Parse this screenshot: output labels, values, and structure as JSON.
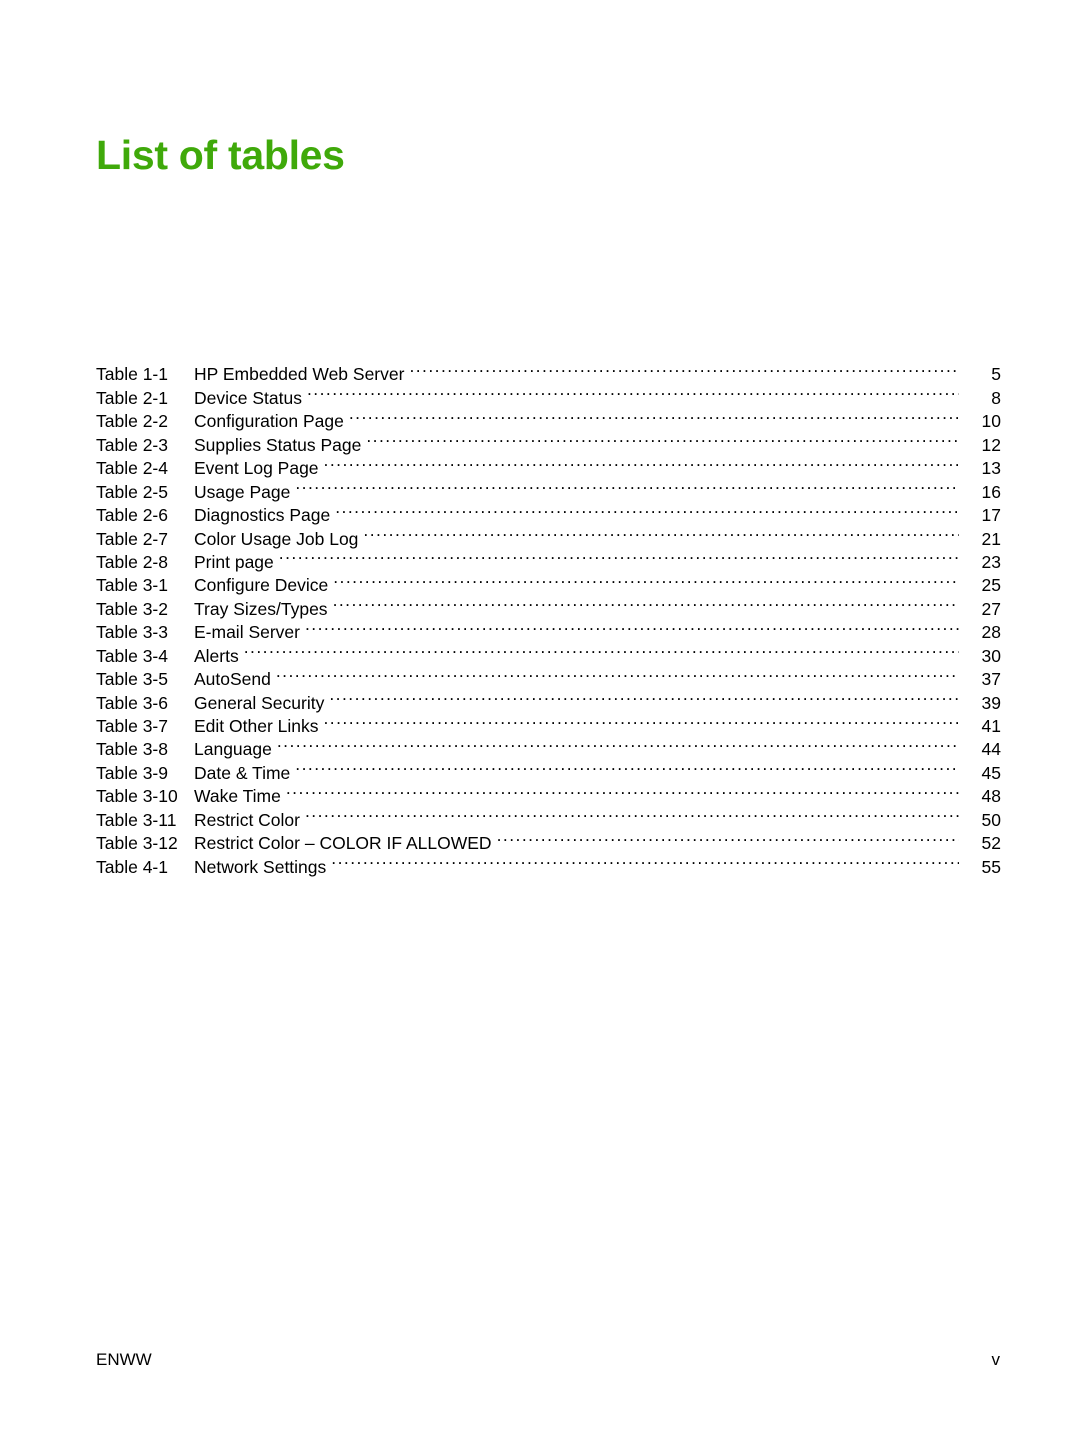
{
  "document": {
    "title": "List of tables",
    "accent_color": "#3fa90a",
    "text_color": "#000000",
    "background_color": "#ffffff"
  },
  "list_of_tables": {
    "entries": [
      {
        "label": "Table 1-1",
        "caption": "HP Embedded Web Server",
        "page": "5"
      },
      {
        "label": "Table 2-1",
        "caption": "Device Status",
        "page": "8"
      },
      {
        "label": "Table 2-2",
        "caption": "Configuration Page",
        "page": "10"
      },
      {
        "label": "Table 2-3",
        "caption": "Supplies Status Page",
        "page": "12"
      },
      {
        "label": "Table 2-4",
        "caption": "Event Log Page",
        "page": "13"
      },
      {
        "label": "Table 2-5",
        "caption": "Usage Page",
        "page": "16"
      },
      {
        "label": "Table 2-6",
        "caption": "Diagnostics Page",
        "page": "17"
      },
      {
        "label": "Table 2-7",
        "caption": "Color Usage Job Log",
        "page": "21"
      },
      {
        "label": "Table 2-8",
        "caption": "Print page",
        "page": "23"
      },
      {
        "label": "Table 3-1",
        "caption": "Configure Device",
        "page": "25"
      },
      {
        "label": "Table 3-2",
        "caption": "Tray Sizes/Types",
        "page": "27"
      },
      {
        "label": "Table 3-3",
        "caption": "E-mail Server",
        "page": "28"
      },
      {
        "label": "Table 3-4",
        "caption": "Alerts",
        "page": "30"
      },
      {
        "label": "Table 3-5",
        "caption": "AutoSend",
        "page": "37"
      },
      {
        "label": "Table 3-6",
        "caption": "General Security",
        "page": "39"
      },
      {
        "label": "Table 3-7",
        "caption": "Edit Other Links",
        "page": "41"
      },
      {
        "label": "Table 3-8",
        "caption": "Language",
        "page": "44"
      },
      {
        "label": "Table 3-9",
        "caption": "Date & Time",
        "page": "45"
      },
      {
        "label": "Table 3-10",
        "caption": "Wake Time",
        "page": "48"
      },
      {
        "label": "Table 3-11",
        "caption": "Restrict Color",
        "page": "50"
      },
      {
        "label": "Table 3-12",
        "caption": "Restrict Color – COLOR IF ALLOWED",
        "page": "52"
      },
      {
        "label": "Table 4-1",
        "caption": "Network Settings",
        "page": "55"
      }
    ]
  },
  "footer": {
    "left": "ENWW",
    "right": "v"
  }
}
